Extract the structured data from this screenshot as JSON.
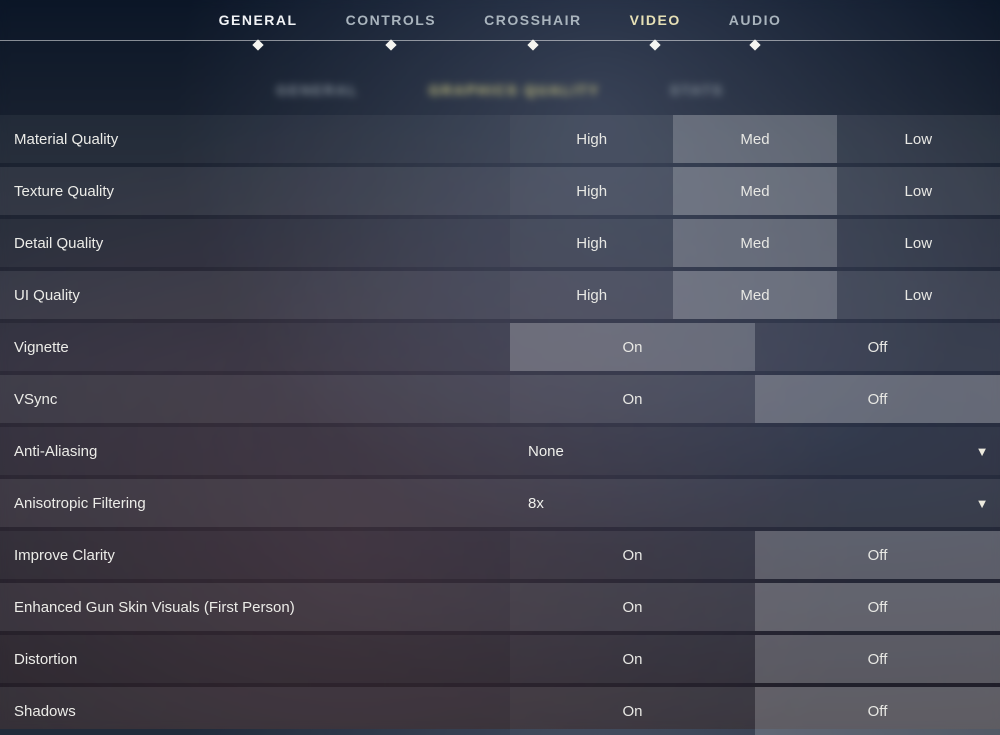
{
  "main_tabs": {
    "general": {
      "label": "GENERAL"
    },
    "controls": {
      "label": "CONTROLS"
    },
    "crosshair": {
      "label": "CROSSHAIR"
    },
    "video": {
      "label": "VIDEO"
    },
    "audio": {
      "label": "AUDIO"
    },
    "active": "video"
  },
  "sub_tabs": {
    "general": {
      "label": "GENERAL"
    },
    "graphics": {
      "label": "GRAPHICS QUALITY"
    },
    "stats": {
      "label": "STATS"
    },
    "active": "graphics"
  },
  "opts3": {
    "high": "High",
    "med": "Med",
    "low": "Low"
  },
  "opts2": {
    "on": "On",
    "off": "Off"
  },
  "rows": {
    "material": {
      "label": "Material Quality",
      "selected": "Med"
    },
    "texture": {
      "label": "Texture Quality",
      "selected": "Med"
    },
    "detail": {
      "label": "Detail Quality",
      "selected": "Med"
    },
    "ui": {
      "label": "UI Quality",
      "selected": "Med"
    },
    "vignette": {
      "label": "Vignette",
      "selected": "On"
    },
    "vsync": {
      "label": "VSync",
      "selected": "Off"
    },
    "aa": {
      "label": "Anti-Aliasing",
      "value": "None"
    },
    "aniso": {
      "label": "Anisotropic Filtering",
      "value": "8x"
    },
    "clarity": {
      "label": "Improve Clarity",
      "selected": "Off"
    },
    "gunskin": {
      "label": "Enhanced Gun Skin Visuals (First Person)",
      "selected": "Off"
    },
    "distort": {
      "label": "Distortion",
      "selected": "Off"
    },
    "shadows": {
      "label": "Shadows",
      "selected": "Off"
    }
  }
}
